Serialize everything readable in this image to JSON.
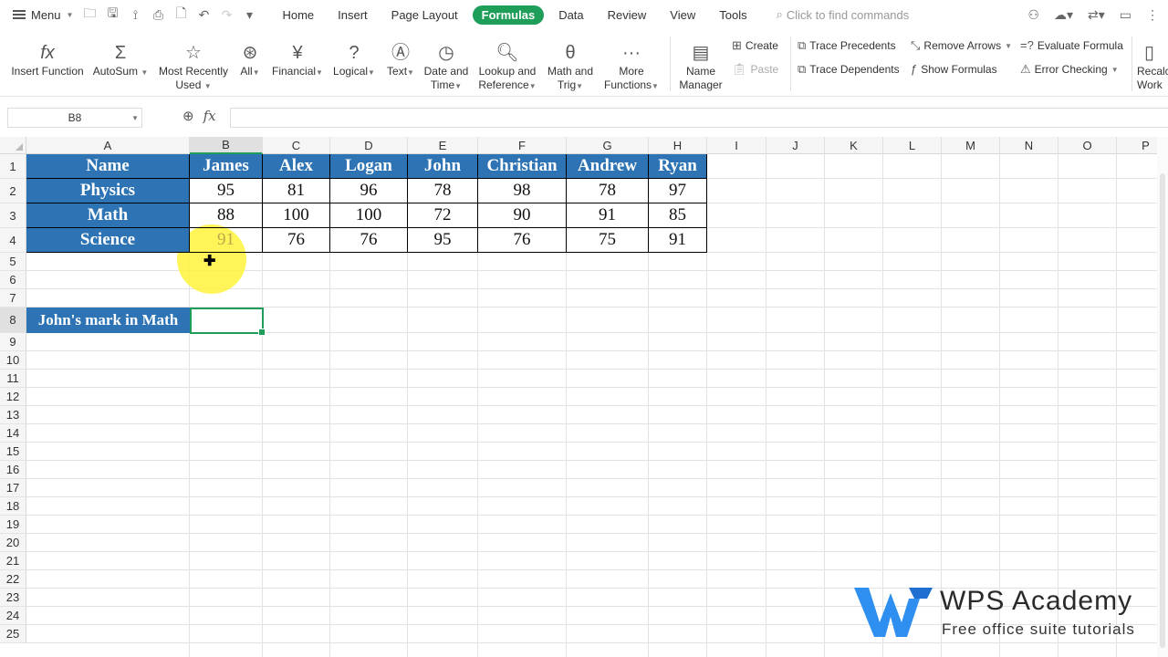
{
  "topbar": {
    "menu_label": "Menu",
    "tabs": [
      "Home",
      "Insert",
      "Page Layout",
      "Formulas",
      "Data",
      "Review",
      "View",
      "Tools"
    ],
    "active_tab": "Formulas",
    "search_placeholder": "Click to find commands"
  },
  "ribbon": {
    "insert_function": "Insert Function",
    "autosum": "AutoSum",
    "most_recently_used_1": "Most Recently",
    "most_recently_used_2": "Used",
    "all": "All",
    "financial": "Financial",
    "logical": "Logical",
    "text": "Text",
    "date_time_1": "Date and",
    "date_time_2": "Time",
    "lookup_1": "Lookup and",
    "lookup_2": "Reference",
    "math_1": "Math and",
    "math_2": "Trig",
    "more_1": "More",
    "more_2": "Functions",
    "name_manager_1": "Name",
    "name_manager_2": "Manager",
    "create": "Create",
    "paste": "Paste",
    "trace_precedents": "Trace Precedents",
    "trace_dependents": "Trace Dependents",
    "remove_arrows": "Remove Arrows",
    "show_formulas": "Show Formulas",
    "evaluate_formula": "Evaluate Formula",
    "error_checking": "Error Checking",
    "recalc_1": "Recalc",
    "recalc_2": "Work"
  },
  "formula_bar": {
    "name_box": "B8",
    "fx": "fx",
    "content": ""
  },
  "sheet": {
    "columns": [
      "A",
      "B",
      "C",
      "D",
      "E",
      "F",
      "G",
      "H",
      "I",
      "J",
      "K",
      "L",
      "M",
      "N",
      "O",
      "P"
    ],
    "rows": [
      "1",
      "2",
      "3",
      "4",
      "5",
      "6",
      "7",
      "8",
      "9",
      "10",
      "11",
      "12",
      "13",
      "14",
      "15",
      "16",
      "17",
      "18",
      "19",
      "20",
      "21",
      "22",
      "23",
      "24",
      "25"
    ],
    "header_row": [
      "Name",
      "James",
      "Alex",
      "Logan",
      "John",
      "Christian",
      "Andrew",
      "Ryan"
    ],
    "data_rows": [
      {
        "subject": "Physics",
        "values": [
          "95",
          "81",
          "96",
          "78",
          "98",
          "78",
          "97"
        ]
      },
      {
        "subject": "Math",
        "values": [
          "88",
          "100",
          "100",
          "72",
          "90",
          "91",
          "85"
        ]
      },
      {
        "subject": "Science",
        "values": [
          "91",
          "76",
          "76",
          "95",
          "76",
          "75",
          "91"
        ]
      }
    ],
    "a8_label": "John's mark in Math",
    "selected_cell": "B8"
  },
  "watermark": {
    "title": "WPS Academy",
    "subtitle": "Free office suite tutorials"
  },
  "colors": {
    "header_fill": "#2e74b5",
    "active_tab": "#1f9e5a",
    "selection": "#1f9e5a",
    "highlight": "#fff33c"
  }
}
